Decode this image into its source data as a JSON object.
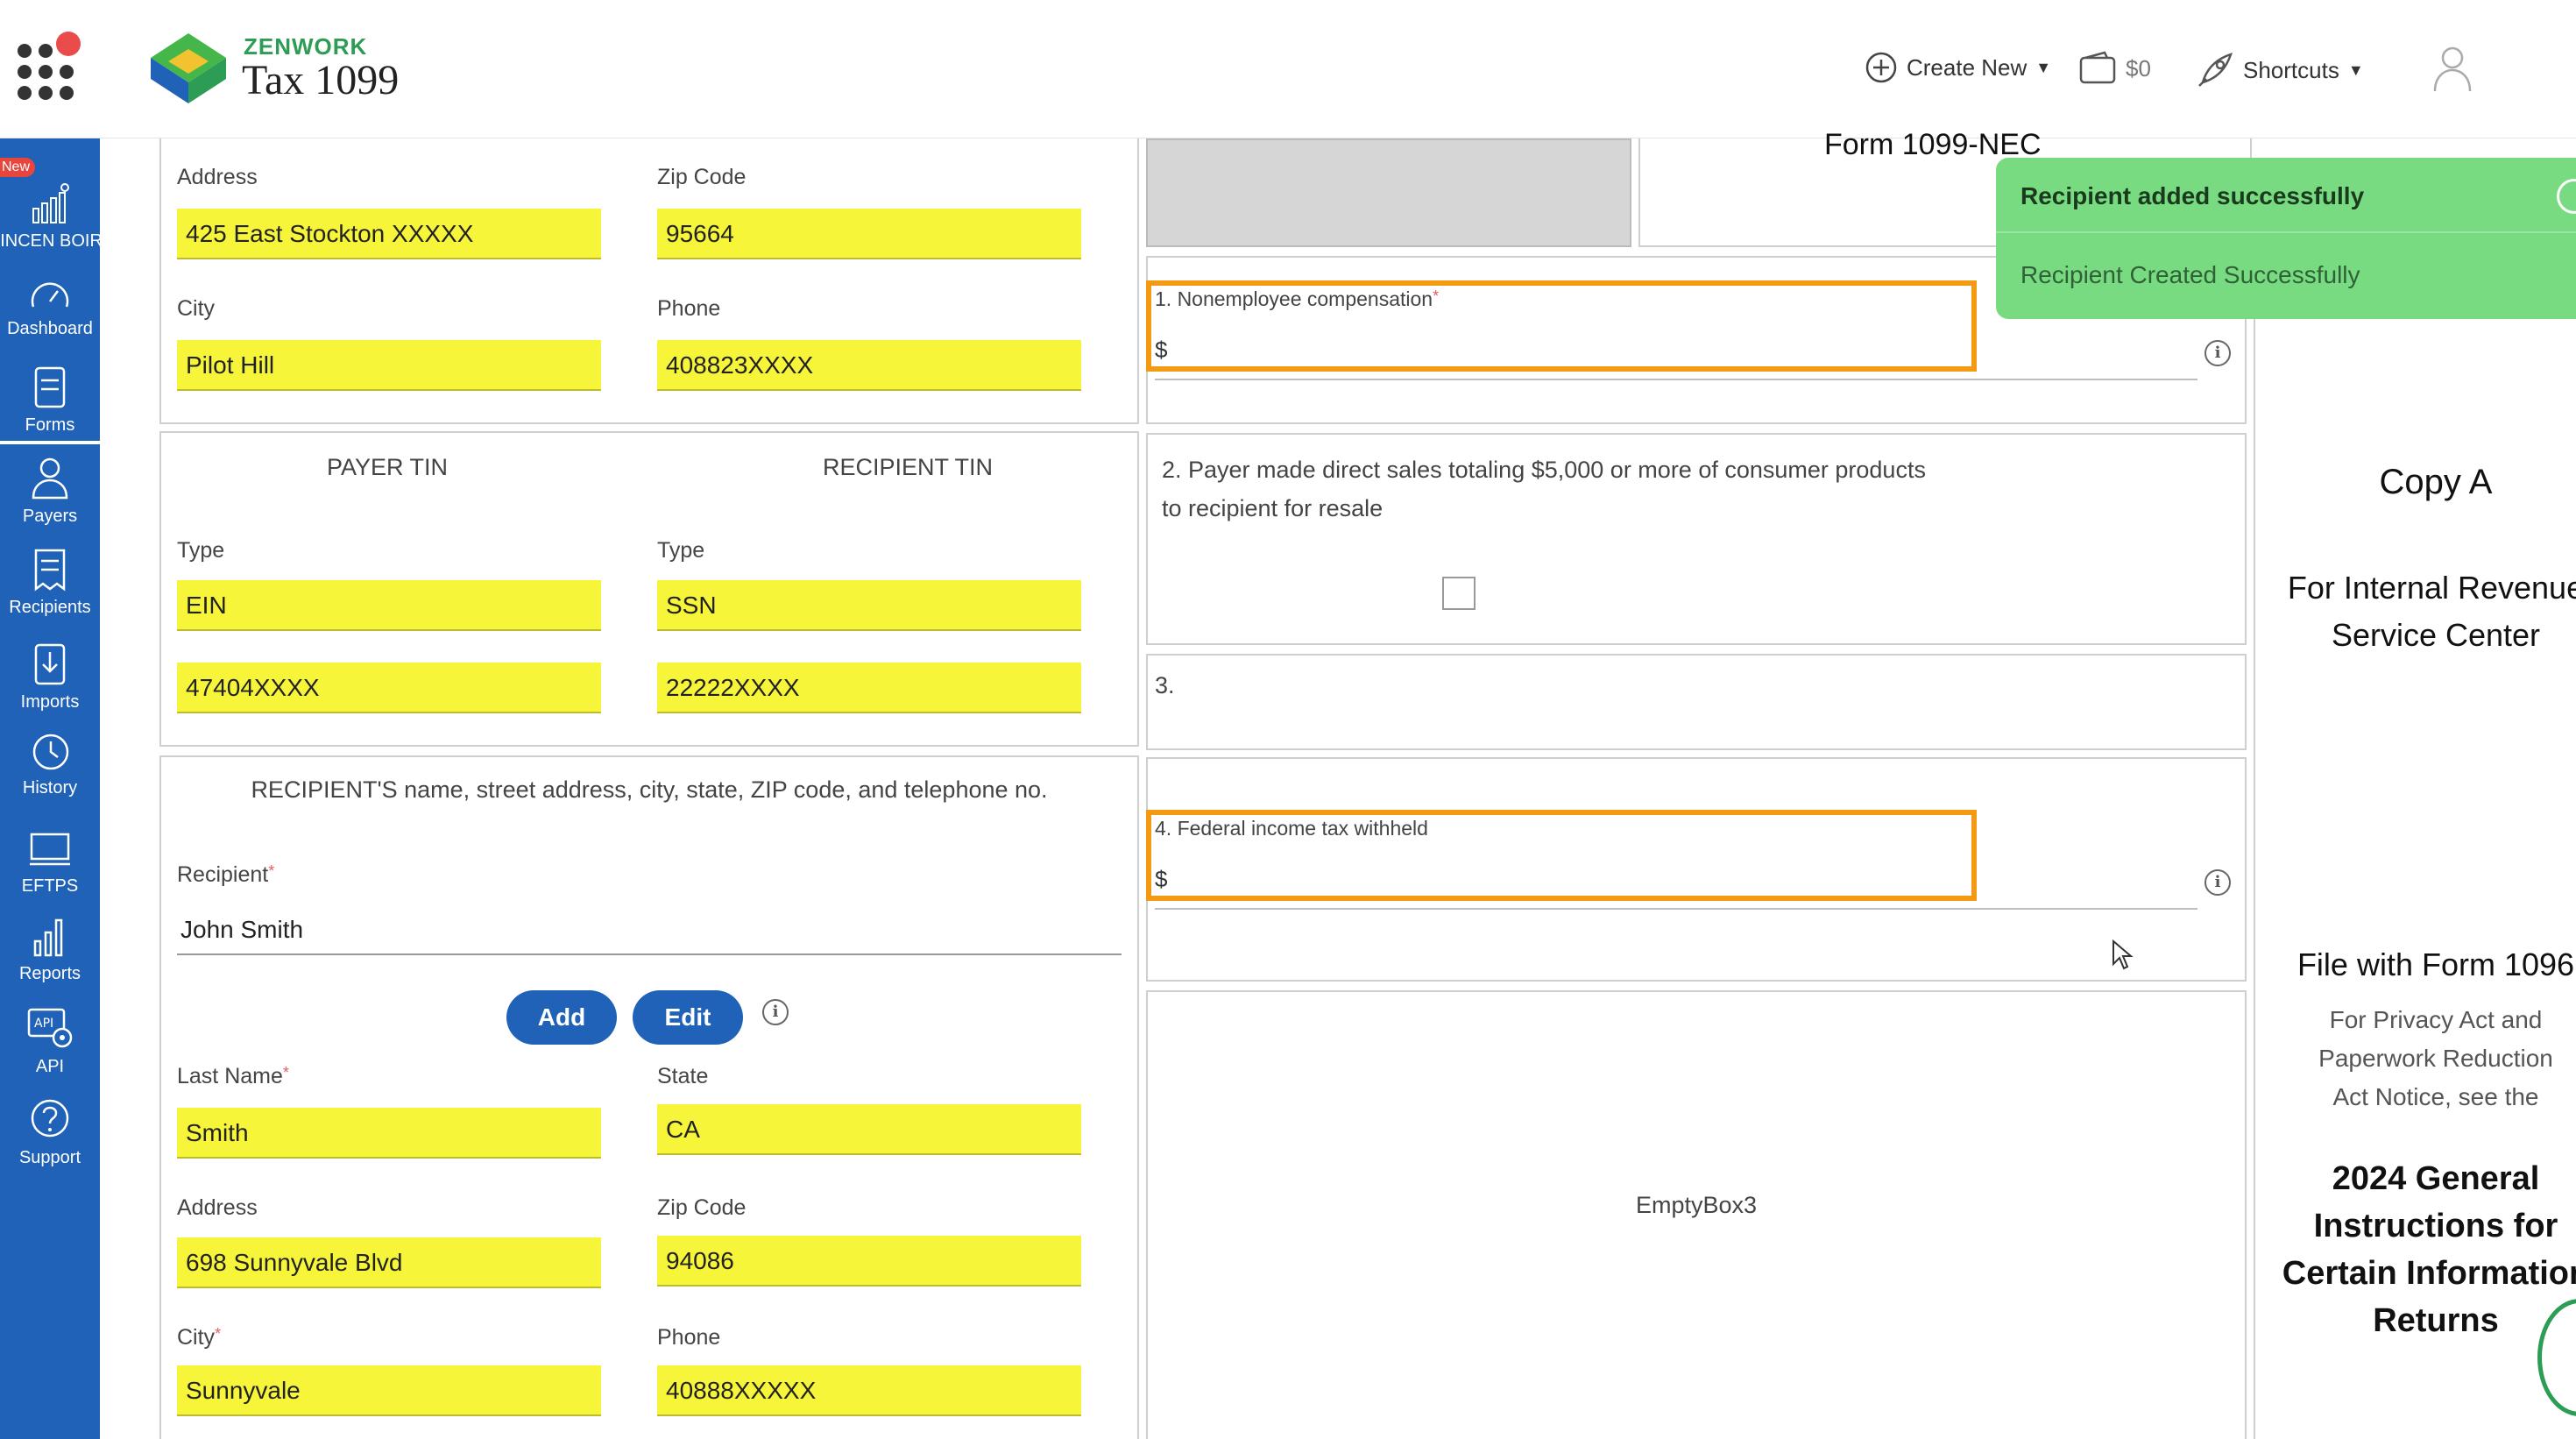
{
  "app": {
    "brand_small": "ZENWORK",
    "brand_name": "Tax 1099"
  },
  "header": {
    "create_new": "Create New",
    "cart_amount": "$0",
    "shortcuts": "Shortcuts"
  },
  "sidebar": {
    "new_badge": "New",
    "items": [
      {
        "label": "FINCEN BOIR",
        "icon": "chart-house-icon"
      },
      {
        "label": "Dashboard",
        "icon": "gauge-icon"
      },
      {
        "label": "Forms",
        "icon": "document-icon"
      },
      {
        "label": "Payers",
        "icon": "user-icon"
      },
      {
        "label": "Recipients",
        "icon": "receipt-icon"
      },
      {
        "label": "Imports",
        "icon": "import-icon"
      },
      {
        "label": "History",
        "icon": "history-icon"
      },
      {
        "label": "EFTPS",
        "icon": "monitor-icon"
      },
      {
        "label": "Reports",
        "icon": "bar-chart-icon"
      },
      {
        "label": "API",
        "icon": "api-icon"
      },
      {
        "label": "Support",
        "icon": "question-icon"
      }
    ]
  },
  "payer_section": {
    "address_label": "Address",
    "address_value": "425  East Stockton XXXXX",
    "zip_label": "Zip Code",
    "zip_value": "95664",
    "city_label": "City",
    "city_value": "Pilot Hill",
    "phone_label": "Phone",
    "phone_value": "408823XXXX"
  },
  "tin_section": {
    "payer_tin_title": "PAYER TIN",
    "recipient_tin_title": "RECIPIENT TIN",
    "payer_type_label": "Type",
    "payer_type_value": "EIN",
    "recipient_type_label": "Type",
    "recipient_type_value": "SSN",
    "payer_tin_value": "47404XXXX",
    "recipient_tin_value": "22222XXXX"
  },
  "recipient_section": {
    "title": "RECIPIENT'S name, street address, city, state, ZIP code, and telephone no.",
    "recipient_label": "Recipient",
    "recipient_value": "John Smith",
    "add_button": "Add",
    "edit_button": "Edit",
    "last_name_label": "Last Name",
    "last_name_value": "Smith",
    "state_label": "State",
    "state_value": "CA",
    "address_label": "Address",
    "address_value": "698 Sunnyvale Blvd",
    "zip_label": "Zip Code",
    "zip_value": "94086",
    "city_label": "City",
    "city_value": "Sunnyvale",
    "phone_label": "Phone",
    "phone_value": "40888XXXXX"
  },
  "boxes": {
    "form_title": "Form 1099-NEC",
    "box1_label": "1. Nonemployee compensation",
    "box1_currency": "$",
    "box2_text": "2. Payer made direct sales totaling $5,000 or more of consumer products to recipient for resale",
    "box3_label": "3.",
    "box4_label": "4. Federal income tax withheld",
    "box4_currency": "$",
    "empty_box": "EmptyBox3"
  },
  "right_column": {
    "copy": "Copy A",
    "for_irs_1": "For Internal Revenue",
    "for_irs_2": "Service Center",
    "file_with": "File with Form 1096",
    "privacy_1": "For Privacy Act and",
    "privacy_2": "Paperwork Reduction",
    "privacy_3": "Act Notice, see the",
    "instructions_1": "2024 General",
    "instructions_2": "Instructions for",
    "instructions_3": "Certain Information",
    "instructions_4": "Returns"
  },
  "toast": {
    "title": "Recipient added successfully",
    "message": "Recipient Created Successfully"
  },
  "colors": {
    "sidebar": "#1f62b7",
    "field_highlight": "#f7f53a",
    "box_highlight": "#f39a12",
    "toast": "#79db81",
    "brand_green": "#2d9c54"
  }
}
